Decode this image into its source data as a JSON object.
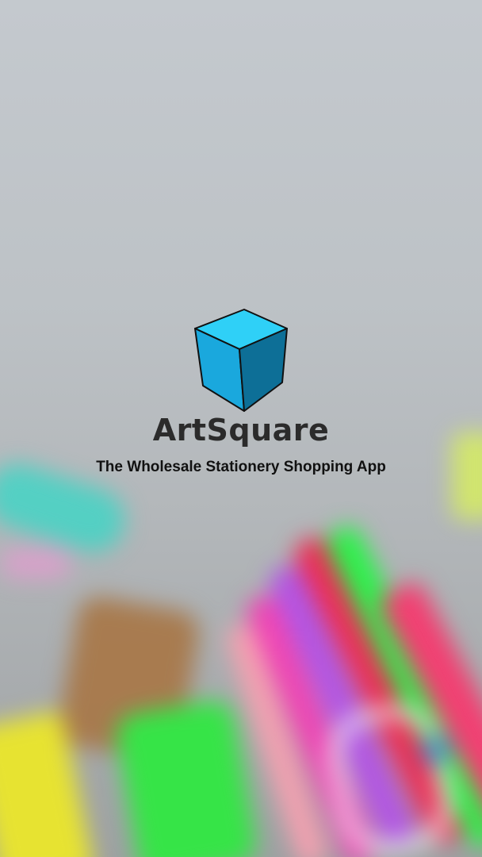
{
  "splash": {
    "logo_icon": "cube-icon",
    "app_name": "ArtSquare",
    "tagline": "The Wholesale Stationery Shopping App"
  },
  "colors": {
    "cube_top": "#2fd0f7",
    "cube_left": "#1aa8dd",
    "cube_right": "#0d6f97",
    "text": "#2b2b2b"
  }
}
